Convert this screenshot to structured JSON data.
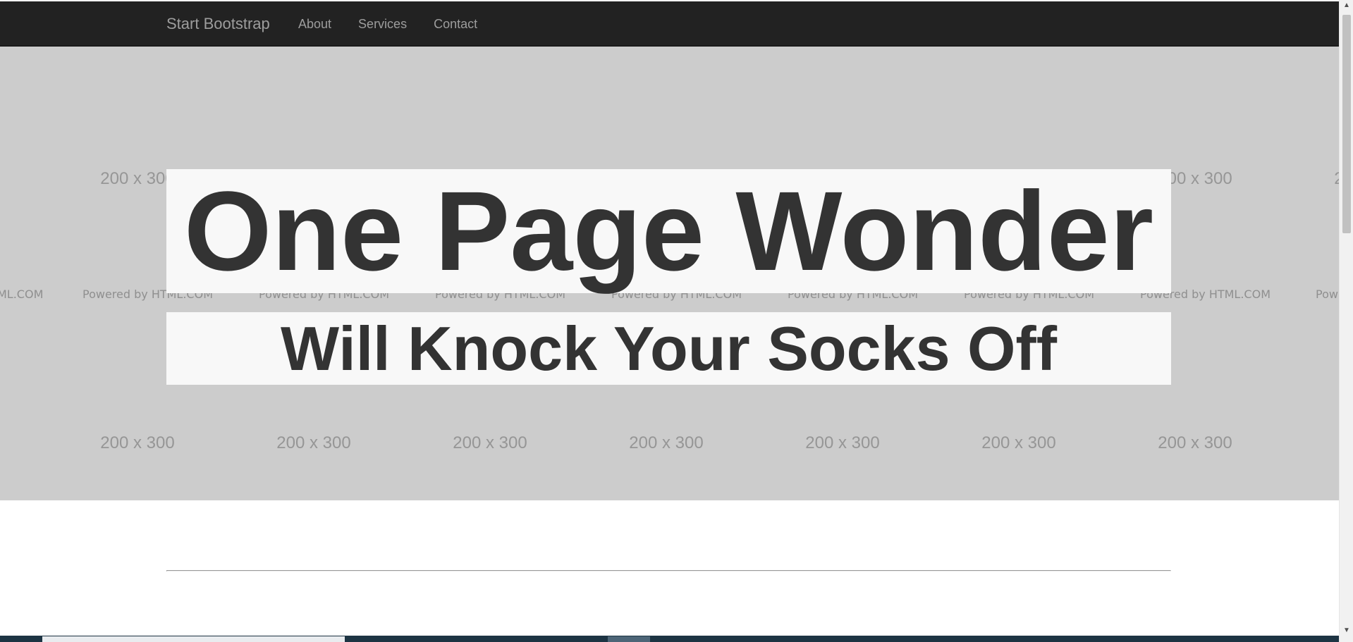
{
  "navbar": {
    "brand": "Start Bootstrap",
    "links": [
      {
        "label": "About"
      },
      {
        "label": "Services"
      },
      {
        "label": "Contact"
      }
    ]
  },
  "header": {
    "title": "One Page Wonder",
    "subtitle": "Will Knock Your Socks Off",
    "placeholder_label": "200 x 300",
    "watermark": "Powered by HTML.COM",
    "watermark_partial_left": "ML.COM",
    "watermark_partial_right": "Pow",
    "background_color": "#cccccc",
    "title_box_color": "#f8f8f8",
    "text_color": "#333333"
  },
  "colors": {
    "navbar": "#222222",
    "nav_text": "#9d9d9d",
    "taskbar": "#1d3443"
  },
  "icons": {
    "scroll_up": "scroll-up-arrow-icon",
    "scroll_down": "scroll-down-arrow-icon"
  }
}
